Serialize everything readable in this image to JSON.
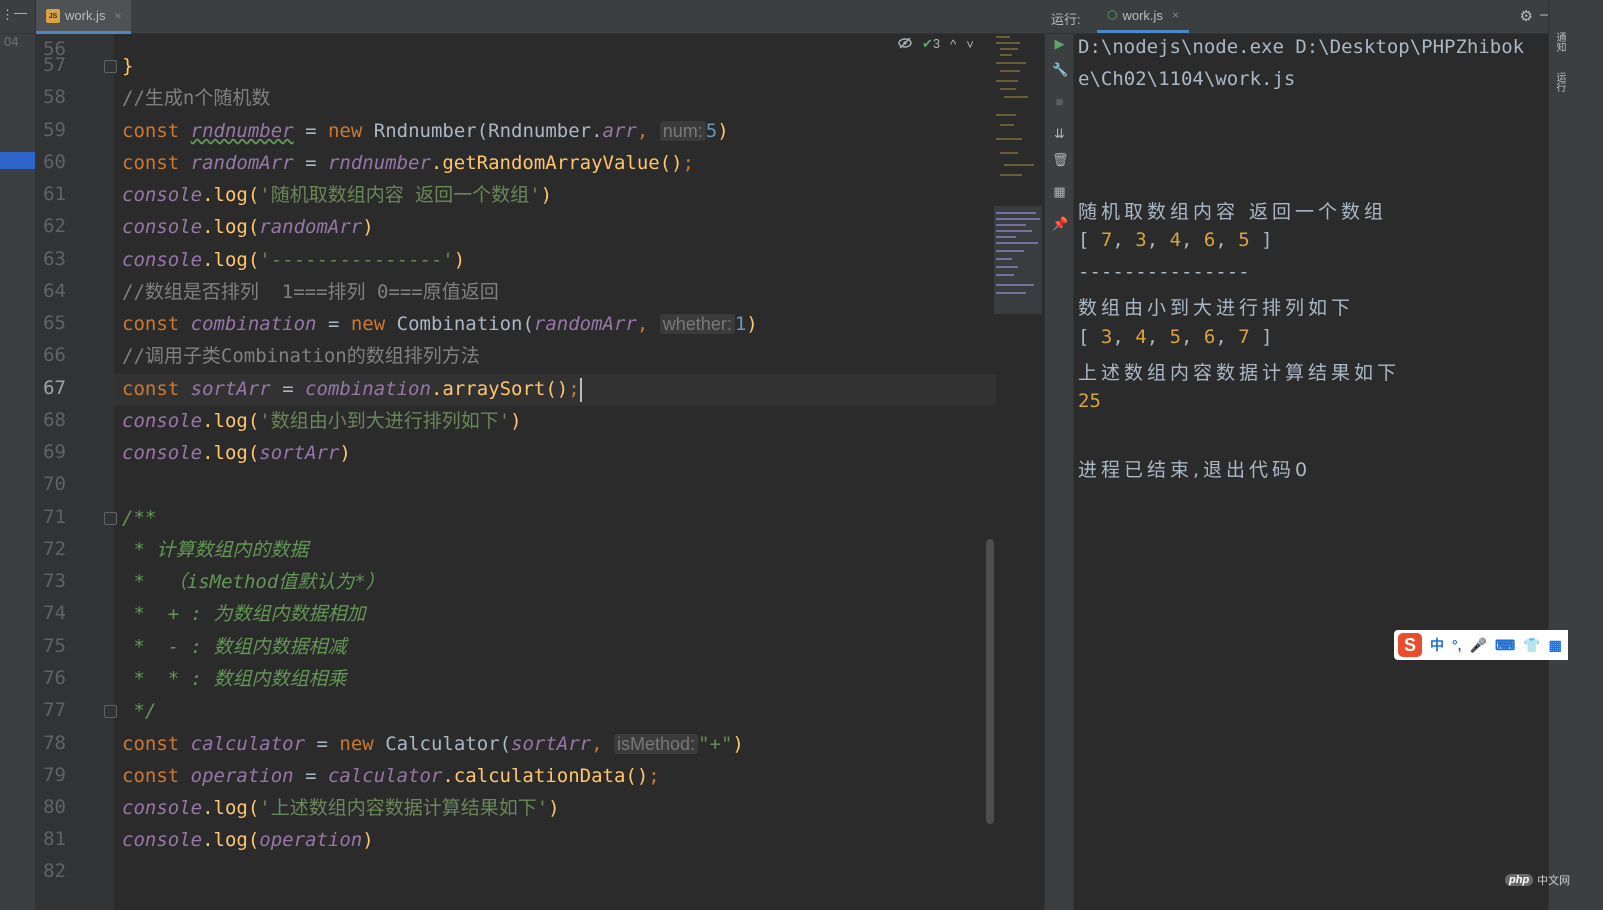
{
  "left_strip": {
    "line_number": "04"
  },
  "editor_tab": {
    "label": "work.js",
    "icon": "js-file-icon",
    "close": "×"
  },
  "inspection": {
    "hidden_icon": "eye-slash-icon",
    "check_count": "3",
    "prev": "^",
    "next": "˅"
  },
  "gutter": {
    "lines": [
      "56",
      "57",
      "58",
      "59",
      "60",
      "61",
      "62",
      "63",
      "64",
      "65",
      "66",
      "67",
      "68",
      "69",
      "70",
      "71",
      "72",
      "73",
      "74",
      "75",
      "76",
      "77",
      "78",
      "79",
      "80",
      "81",
      "82"
    ]
  },
  "code": {
    "l57": "}",
    "l58": "//生成n个随机数",
    "l59": {
      "kw": "const",
      "name": "rndnumber",
      "eq": "=",
      "new": "new",
      "cls": "Rndnumber(Rndnumber.",
      "prop": "arr",
      "comma": ",",
      "hint": "num:",
      "num": "5",
      "close": ")"
    },
    "l60": {
      "kw": "const",
      "name": "randomArr",
      "eq": "=",
      "obj": "rndnumber",
      "method": ".getRandomArrayValue()",
      "semi": ";"
    },
    "l61": {
      "obj": "console",
      "call": ".log(",
      "str": "'随机取数组内容 返回一个数组'",
      "close": ")"
    },
    "l62": {
      "obj": "console",
      "call": ".log(",
      "arg": "randomArr",
      "close": ")"
    },
    "l63": {
      "obj": "console",
      "call": ".log(",
      "str": "'---------------'",
      "close": ")"
    },
    "l64": "//数组是否排列  1===排列 0===原值返回",
    "l65": {
      "kw": "const",
      "name": "combination",
      "eq": "=",
      "new": "new",
      "cls": "Combination(",
      "arg": "randomArr",
      "comma": ",",
      "hint": "whether:",
      "num": "1",
      "close": ")"
    },
    "l66": "//调用子类Combination的数组排列方法",
    "l67": {
      "kw": "const",
      "name": "sortArr",
      "eq": "=",
      "obj": "combination",
      "method": ".arraySort()",
      "semi": ";"
    },
    "l68": {
      "obj": "console",
      "call": ".log(",
      "str": "'数组由小到大进行排列如下'",
      "close": ")"
    },
    "l69": {
      "obj": "console",
      "call": ".log(",
      "arg": "sortArr",
      "close": ")"
    },
    "l71": "/**",
    "l72": " * 计算数组内的数据",
    "l73": " *  （isMethod值默认为*）",
    "l74": " *  + : 为数组内数据相加",
    "l75": " *  - : 数组内数据相减",
    "l76": " *  * : 数组内数组相乘",
    "l77": " */",
    "l78": {
      "kw": "const",
      "name": "calculator",
      "eq": "=",
      "new": "new",
      "cls": "Calculator(",
      "arg": "sortArr",
      "comma": ",",
      "hint": "isMethod:",
      "str": "\"+\"",
      "close": ")"
    },
    "l79": {
      "kw": "const",
      "name": "operation",
      "eq": "=",
      "obj": "calculator",
      "method": ".calculationData()",
      "semi": ";"
    },
    "l80": {
      "obj": "console",
      "call": ".log(",
      "str": "'上述数组内容数据计算结果如下'",
      "close": ")"
    },
    "l81": {
      "obj": "console",
      "call": ".log(",
      "arg": "operation",
      "close": ")"
    }
  },
  "run_panel": {
    "label": "运行:",
    "tab_label": "work.js",
    "tab_close": "×",
    "tools": [
      "play-icon",
      "wrench-icon",
      "stop-icon",
      "scroll-to-end-icon",
      "trash-icon",
      "layout-icon",
      "pin-icon"
    ],
    "console": {
      "cmd1": "D:\\nodejs\\node.exe D:\\Desktop\\PHPZhibok",
      "cmd2": "e\\Ch02\\1104\\work.js",
      "out1": "随机取数组内容 返回一个数组",
      "arr1": {
        "open": "[ ",
        "values": [
          "7",
          "3",
          "4",
          "6",
          "5"
        ],
        "sep": ", ",
        "close": " ]"
      },
      "dashes": "---------------",
      "out2": "数组由小到大进行排列如下",
      "arr2": {
        "open": "[ ",
        "values": [
          "3",
          "4",
          "5",
          "6",
          "7"
        ],
        "sep": ", ",
        "close": " ]"
      },
      "out3": "上述数组内容数据计算结果如下",
      "result": "25",
      "exit": "进程已结束,退出代码0"
    }
  },
  "right_strip": {
    "label1": "通知",
    "label2": "运行"
  },
  "ime": {
    "logo": "S",
    "items": [
      "中",
      "°,",
      "🎤",
      "⌨",
      "👕",
      "▦"
    ]
  },
  "watermark": {
    "logo": "php",
    "text": "中文网"
  },
  "colors": {
    "keyword": "#cc7832",
    "variable": "#9876aa",
    "string": "#6a8759",
    "function": "#ffc66d",
    "number": "#6897bb",
    "doc_comment": "#629755",
    "background": "#2b2b2b"
  }
}
